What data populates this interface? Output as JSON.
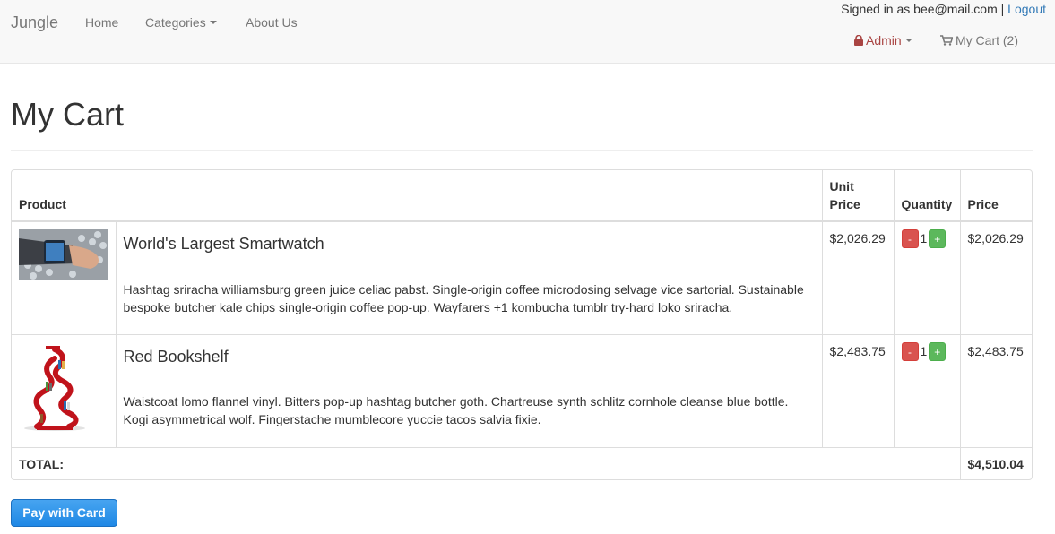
{
  "nav": {
    "brand": "Jungle",
    "home": "Home",
    "categories": "Categories",
    "about": "About Us",
    "signed_in_text": "Signed in as bee@mail.com |",
    "logout": "Logout",
    "admin": "Admin",
    "cart": "My Cart (2)"
  },
  "page": {
    "title": "My Cart"
  },
  "table": {
    "headers": {
      "product": "Product",
      "unit_price": "Unit Price",
      "quantity": "Quantity",
      "price": "Price"
    },
    "rows": [
      {
        "name": "World's Largest Smartwatch",
        "description": "Hashtag sriracha williamsburg green juice celiac pabst. Single-origin coffee microdosing selvage vice sartorial. Sustainable bespoke butcher kale chips single-origin coffee pop-up. Wayfarers +1 kombucha tumblr try-hard loko sriracha.",
        "unit_price": "$2,026.29",
        "quantity": "1",
        "price": "$2,026.29",
        "minus_label": "-",
        "plus_label": "+"
      },
      {
        "name": "Red Bookshelf",
        "description": "Waistcoat lomo flannel vinyl. Bitters pop-up hashtag butcher goth. Chartreuse synth schlitz cornhole cleanse blue bottle. Kogi asymmetrical wolf. Fingerstache mumblecore yuccie tacos salvia fixie.",
        "unit_price": "$2,483.75",
        "quantity": "1",
        "price": "$2,483.75",
        "minus_label": "-",
        "plus_label": "+"
      }
    ],
    "total_label": "TOTAL:",
    "total_value": "$4,510.04"
  },
  "actions": {
    "pay": "Pay with Card"
  },
  "icons": {
    "lock": "lock-icon",
    "cart": "shopping-cart-icon"
  },
  "colors": {
    "admin": "#a94442",
    "link": "#337ab7",
    "minus": "#d9534f",
    "plus": "#5cb85c",
    "pay": "#1f88e5"
  }
}
